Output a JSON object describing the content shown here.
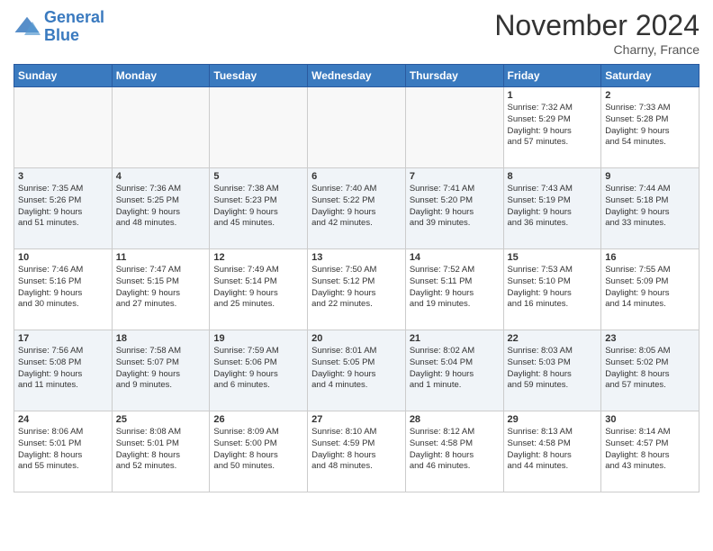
{
  "header": {
    "logo_line1": "General",
    "logo_line2": "Blue",
    "month": "November 2024",
    "location": "Charny, France"
  },
  "weekdays": [
    "Sunday",
    "Monday",
    "Tuesday",
    "Wednesday",
    "Thursday",
    "Friday",
    "Saturday"
  ],
  "weeks": [
    [
      {
        "day": "",
        "info": ""
      },
      {
        "day": "",
        "info": ""
      },
      {
        "day": "",
        "info": ""
      },
      {
        "day": "",
        "info": ""
      },
      {
        "day": "",
        "info": ""
      },
      {
        "day": "1",
        "info": "Sunrise: 7:32 AM\nSunset: 5:29 PM\nDaylight: 9 hours\nand 57 minutes."
      },
      {
        "day": "2",
        "info": "Sunrise: 7:33 AM\nSunset: 5:28 PM\nDaylight: 9 hours\nand 54 minutes."
      }
    ],
    [
      {
        "day": "3",
        "info": "Sunrise: 7:35 AM\nSunset: 5:26 PM\nDaylight: 9 hours\nand 51 minutes."
      },
      {
        "day": "4",
        "info": "Sunrise: 7:36 AM\nSunset: 5:25 PM\nDaylight: 9 hours\nand 48 minutes."
      },
      {
        "day": "5",
        "info": "Sunrise: 7:38 AM\nSunset: 5:23 PM\nDaylight: 9 hours\nand 45 minutes."
      },
      {
        "day": "6",
        "info": "Sunrise: 7:40 AM\nSunset: 5:22 PM\nDaylight: 9 hours\nand 42 minutes."
      },
      {
        "day": "7",
        "info": "Sunrise: 7:41 AM\nSunset: 5:20 PM\nDaylight: 9 hours\nand 39 minutes."
      },
      {
        "day": "8",
        "info": "Sunrise: 7:43 AM\nSunset: 5:19 PM\nDaylight: 9 hours\nand 36 minutes."
      },
      {
        "day": "9",
        "info": "Sunrise: 7:44 AM\nSunset: 5:18 PM\nDaylight: 9 hours\nand 33 minutes."
      }
    ],
    [
      {
        "day": "10",
        "info": "Sunrise: 7:46 AM\nSunset: 5:16 PM\nDaylight: 9 hours\nand 30 minutes."
      },
      {
        "day": "11",
        "info": "Sunrise: 7:47 AM\nSunset: 5:15 PM\nDaylight: 9 hours\nand 27 minutes."
      },
      {
        "day": "12",
        "info": "Sunrise: 7:49 AM\nSunset: 5:14 PM\nDaylight: 9 hours\nand 25 minutes."
      },
      {
        "day": "13",
        "info": "Sunrise: 7:50 AM\nSunset: 5:12 PM\nDaylight: 9 hours\nand 22 minutes."
      },
      {
        "day": "14",
        "info": "Sunrise: 7:52 AM\nSunset: 5:11 PM\nDaylight: 9 hours\nand 19 minutes."
      },
      {
        "day": "15",
        "info": "Sunrise: 7:53 AM\nSunset: 5:10 PM\nDaylight: 9 hours\nand 16 minutes."
      },
      {
        "day": "16",
        "info": "Sunrise: 7:55 AM\nSunset: 5:09 PM\nDaylight: 9 hours\nand 14 minutes."
      }
    ],
    [
      {
        "day": "17",
        "info": "Sunrise: 7:56 AM\nSunset: 5:08 PM\nDaylight: 9 hours\nand 11 minutes."
      },
      {
        "day": "18",
        "info": "Sunrise: 7:58 AM\nSunset: 5:07 PM\nDaylight: 9 hours\nand 9 minutes."
      },
      {
        "day": "19",
        "info": "Sunrise: 7:59 AM\nSunset: 5:06 PM\nDaylight: 9 hours\nand 6 minutes."
      },
      {
        "day": "20",
        "info": "Sunrise: 8:01 AM\nSunset: 5:05 PM\nDaylight: 9 hours\nand 4 minutes."
      },
      {
        "day": "21",
        "info": "Sunrise: 8:02 AM\nSunset: 5:04 PM\nDaylight: 9 hours\nand 1 minute."
      },
      {
        "day": "22",
        "info": "Sunrise: 8:03 AM\nSunset: 5:03 PM\nDaylight: 8 hours\nand 59 minutes."
      },
      {
        "day": "23",
        "info": "Sunrise: 8:05 AM\nSunset: 5:02 PM\nDaylight: 8 hours\nand 57 minutes."
      }
    ],
    [
      {
        "day": "24",
        "info": "Sunrise: 8:06 AM\nSunset: 5:01 PM\nDaylight: 8 hours\nand 55 minutes."
      },
      {
        "day": "25",
        "info": "Sunrise: 8:08 AM\nSunset: 5:01 PM\nDaylight: 8 hours\nand 52 minutes."
      },
      {
        "day": "26",
        "info": "Sunrise: 8:09 AM\nSunset: 5:00 PM\nDaylight: 8 hours\nand 50 minutes."
      },
      {
        "day": "27",
        "info": "Sunrise: 8:10 AM\nSunset: 4:59 PM\nDaylight: 8 hours\nand 48 minutes."
      },
      {
        "day": "28",
        "info": "Sunrise: 8:12 AM\nSunset: 4:58 PM\nDaylight: 8 hours\nand 46 minutes."
      },
      {
        "day": "29",
        "info": "Sunrise: 8:13 AM\nSunset: 4:58 PM\nDaylight: 8 hours\nand 44 minutes."
      },
      {
        "day": "30",
        "info": "Sunrise: 8:14 AM\nSunset: 4:57 PM\nDaylight: 8 hours\nand 43 minutes."
      }
    ]
  ]
}
